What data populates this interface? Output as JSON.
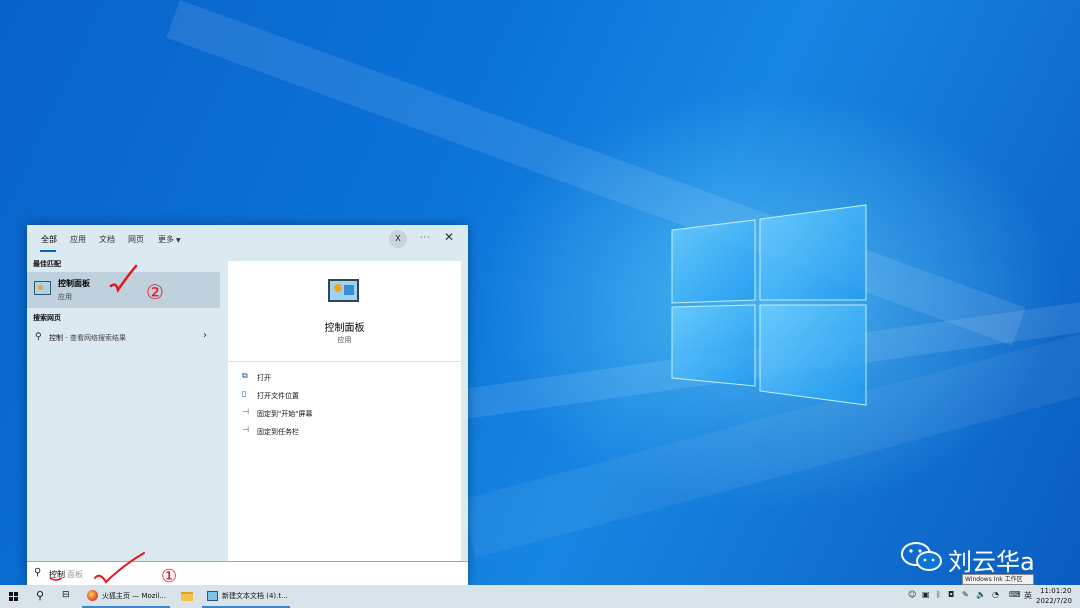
{
  "watermark": {
    "text": "刘云华a",
    "icon": "wechat-icon"
  },
  "ink_tooltip": "Windows Ink 工作区",
  "search_panel": {
    "tabs": [
      {
        "label": "全部",
        "active": true
      },
      {
        "label": "应用"
      },
      {
        "label": "文档"
      },
      {
        "label": "网页"
      },
      {
        "label": "更多"
      }
    ],
    "avatar_initial": "X",
    "more_options": "···",
    "close": "✕",
    "best_match_title": "最佳匹配",
    "best_match": {
      "name": "控制面板",
      "type": "应用",
      "icon": "control-panel-icon"
    },
    "web_title": "搜索网页",
    "web_result": {
      "query": "控制",
      "suffix": " - 查看网络搜索结果"
    },
    "detail": {
      "name": "控制面板",
      "type": "应用",
      "actions": [
        {
          "label": "打开",
          "icon": "open-icon"
        },
        {
          "label": "打开文件位置",
          "icon": "file-location-icon"
        },
        {
          "label": "固定到\"开始\"屏幕",
          "icon": "pin-icon"
        },
        {
          "label": "固定到任务栏",
          "icon": "pin-icon"
        }
      ]
    },
    "search_box": {
      "typed": "控制",
      "completion": "面板"
    }
  },
  "annotations": {
    "marks": [
      "①",
      "②"
    ]
  },
  "taskbar": {
    "apps": [
      {
        "label": "火狐主页 — Mozil...",
        "icon": "firefox-icon"
      },
      {
        "label": "",
        "icon": "file-explorer-icon"
      },
      {
        "label": "新建文本文档 (4).t...",
        "icon": "notepad-icon"
      }
    ],
    "ime": "英",
    "time": "11:01:20",
    "date": "2022/7/20"
  },
  "colors": {
    "accent": "#0067c0",
    "wallpaper": "#0b74d9",
    "annotation": "#e8141c"
  }
}
